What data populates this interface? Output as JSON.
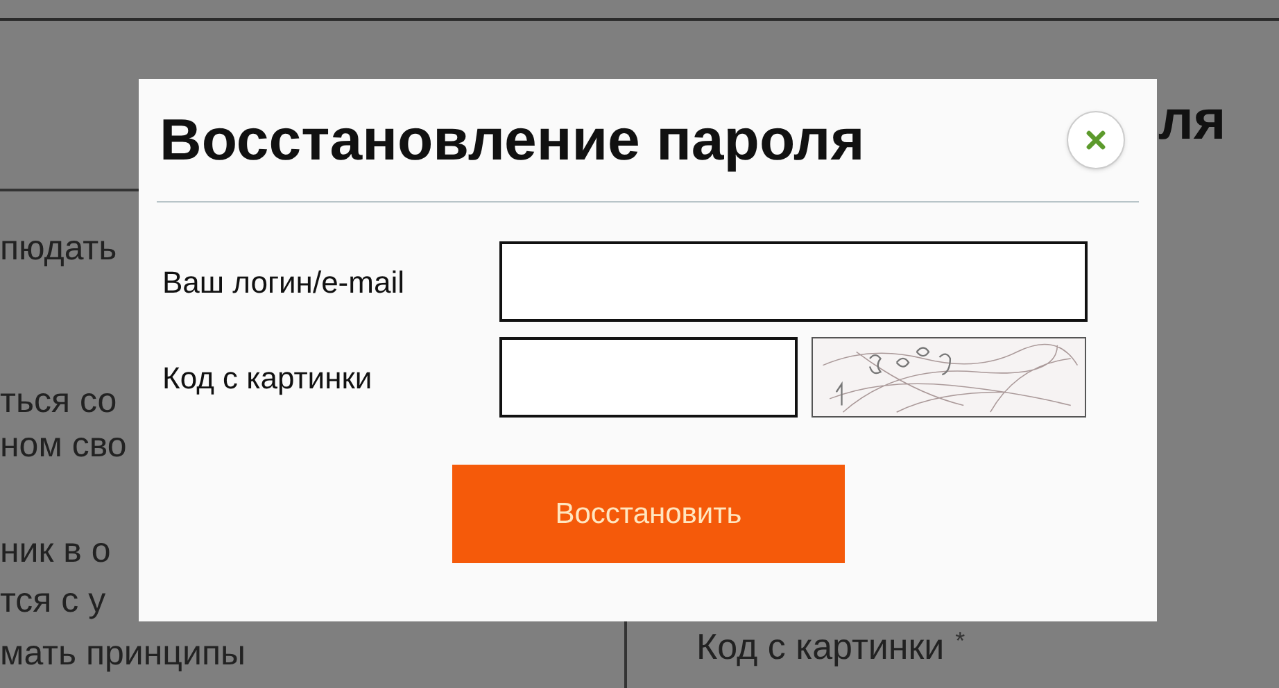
{
  "background": {
    "left_fragments": [
      "пюдать",
      "ться со",
      "ном сво",
      "ник в о",
      "тся с у",
      "мать принципы"
    ],
    "heading_fragment": "ля",
    "captcha_label": "Код с картинки",
    "required_mark": "*"
  },
  "dialog": {
    "title": "Восстановление пароля",
    "fields": [
      {
        "kind": "text",
        "label": "Ваш логин/e-mail"
      },
      {
        "kind": "captcha",
        "label": "Код с картинки"
      }
    ],
    "submit": "Восстановить"
  }
}
